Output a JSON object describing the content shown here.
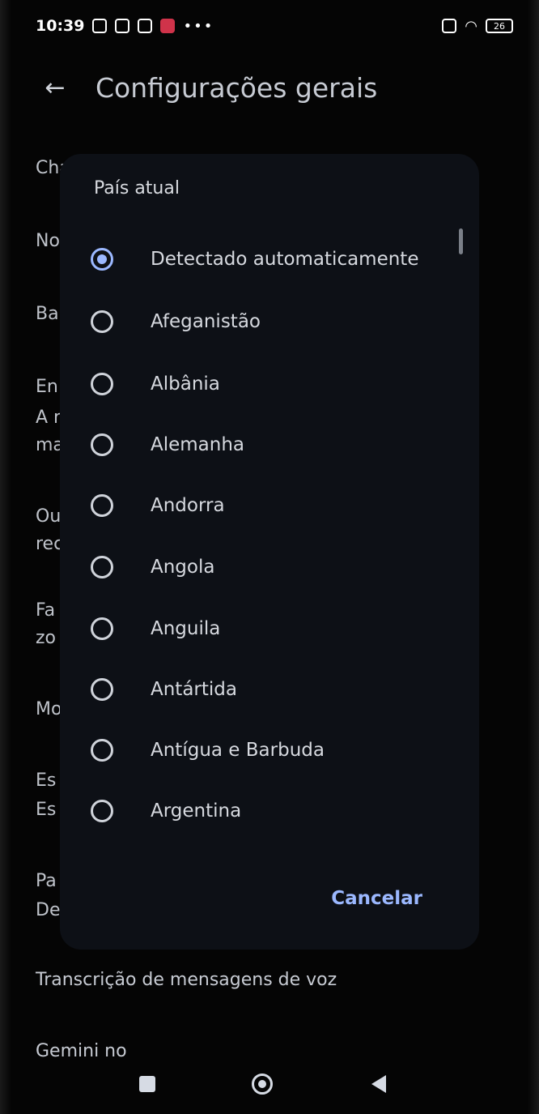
{
  "status_bar": {
    "time": "10:39",
    "battery": "26",
    "more_label": "•••"
  },
  "app_bar": {
    "title": "Configurações gerais"
  },
  "background_items": [
    {
      "label": "Cha"
    },
    {
      "label": "No"
    },
    {
      "label": "Ba"
    },
    {
      "label": "En"
    },
    {
      "label": "A r"
    },
    {
      "label": "ma"
    },
    {
      "label": "Ou"
    },
    {
      "label": "rec"
    },
    {
      "label": "Fa"
    },
    {
      "label": "zo"
    },
    {
      "label": "Mo"
    },
    {
      "label": "Es"
    },
    {
      "label": "Es"
    },
    {
      "label": "Pa"
    },
    {
      "label": "De"
    }
  ],
  "bottom_items": [
    {
      "label": "Transcrição de mensagens de voz"
    },
    {
      "label": "Gemini no"
    }
  ],
  "dialog": {
    "title": "País atual",
    "options": [
      {
        "label": "Detectado automaticamente",
        "checked": true
      },
      {
        "label": "Afeganistão",
        "checked": false
      },
      {
        "label": "Albânia",
        "checked": false
      },
      {
        "label": "Alemanha",
        "checked": false
      },
      {
        "label": "Andorra",
        "checked": false
      },
      {
        "label": "Angola",
        "checked": false
      },
      {
        "label": "Anguila",
        "checked": false
      },
      {
        "label": "Antártida",
        "checked": false
      },
      {
        "label": "Antígua e Barbuda",
        "checked": false
      },
      {
        "label": "Argentina",
        "checked": false
      }
    ],
    "cancel_label": "Cancelar"
  },
  "colors": {
    "accent": "#9bb8ff",
    "toggle": "#3f6fe0",
    "dialog_bg": "#0d1016",
    "page_bg": "#050505"
  },
  "icons": {
    "back": "arrow-left-icon",
    "recents": "square-icon",
    "home": "circle-icon",
    "nav_back": "triangle-back-icon"
  }
}
